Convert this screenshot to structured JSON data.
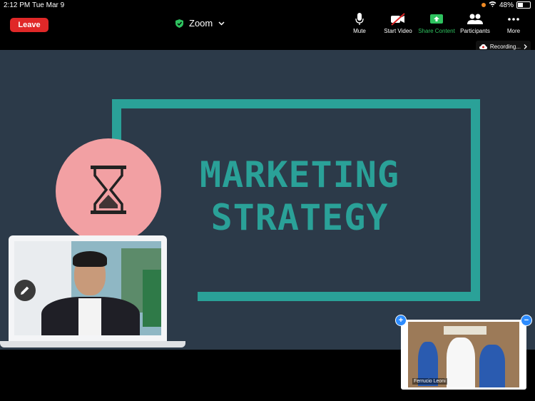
{
  "status_bar": {
    "time": "2:12 PM",
    "date": "Tue Mar 9",
    "battery": "48%"
  },
  "toolbar": {
    "leave_label": "Leave",
    "meeting_title": "Zoom",
    "tools": [
      {
        "label": "Mute",
        "icon": "mic-icon"
      },
      {
        "label": "Start Video",
        "icon": "video-off-icon"
      },
      {
        "label": "Share Content",
        "icon": "share-icon"
      },
      {
        "label": "Participants",
        "icon": "participants-icon"
      },
      {
        "label": "More",
        "icon": "more-icon"
      }
    ]
  },
  "recording_label": "Recording...",
  "slide": {
    "line1": "MARKETING",
    "line2": "STRATEGY"
  },
  "participant": {
    "name": "Ferrucio Leoni"
  },
  "colors": {
    "accent": "#2aa198",
    "slide_bg": "#2c3a49",
    "circle": "#f2a0a3",
    "leave": "#e02828",
    "share": "#2ec25f"
  }
}
